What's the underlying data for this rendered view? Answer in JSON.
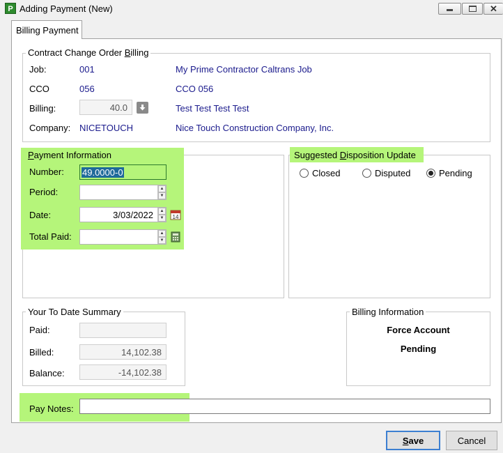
{
  "window": {
    "title": "Adding Payment  (New)",
    "app_icon_letter": "P",
    "controls": [
      "minimize",
      "maximize",
      "close"
    ]
  },
  "tabs": [
    {
      "label": "Billing Payment",
      "active": true
    }
  ],
  "contract": {
    "legend_prefix": "Contract Change Order ",
    "legend_underlined": "B",
    "legend_suffix": "illing",
    "job_label": "Job:",
    "job_value": "001",
    "job_name": "My Prime Contractor Caltrans Job",
    "cco_label": "CCO",
    "cco_value": "056",
    "cco_name": "CCO 056",
    "billing_label": "Billing:",
    "billing_value": "40.0",
    "billing_desc": "Test Test Test Test",
    "company_label": "Company:",
    "company_value": "NICETOUCH",
    "company_name": "Nice Touch Construction Company, Inc."
  },
  "payment": {
    "legend_underlined": "P",
    "legend_suffix": "ayment Information",
    "number_label": "Number:",
    "number_value": "49.0000-0",
    "period_label": "Period:",
    "period_value": "",
    "date_label": "Date:",
    "date_value": "3/03/2022",
    "total_label": "Total Paid:",
    "total_value": ""
  },
  "disposition": {
    "legend_prefix": "Suggested ",
    "legend_underlined": "D",
    "legend_suffix": "isposition Update",
    "options": [
      {
        "label": "Closed",
        "checked": false
      },
      {
        "label": "Disputed",
        "checked": false
      },
      {
        "label": "Pending",
        "checked": true
      }
    ]
  },
  "summary": {
    "legend": "Your To Date Summary",
    "paid_label": "Paid:",
    "paid_value": "",
    "billed_label": "Billed:",
    "billed_value": "14,102.38",
    "balance_label": "Balance:",
    "balance_value": "-14,102.38"
  },
  "billing_info": {
    "legend": "Billing Information",
    "line1": "Force Account",
    "line2": "Pending"
  },
  "notes": {
    "label": "Pay Notes:",
    "value": ""
  },
  "buttons": {
    "save_underlined": "S",
    "save_rest": "ave",
    "cancel": "Cancel"
  },
  "colors": {
    "highlight": "#b5f57a",
    "link_blue": "#1a1a8c",
    "default_button_border": "#3c7fd1",
    "selected_text_bg": "#1f6a9a"
  },
  "icons": [
    "app-icon",
    "download-arrow-icon",
    "calendar-icon",
    "calculator-icon"
  ]
}
